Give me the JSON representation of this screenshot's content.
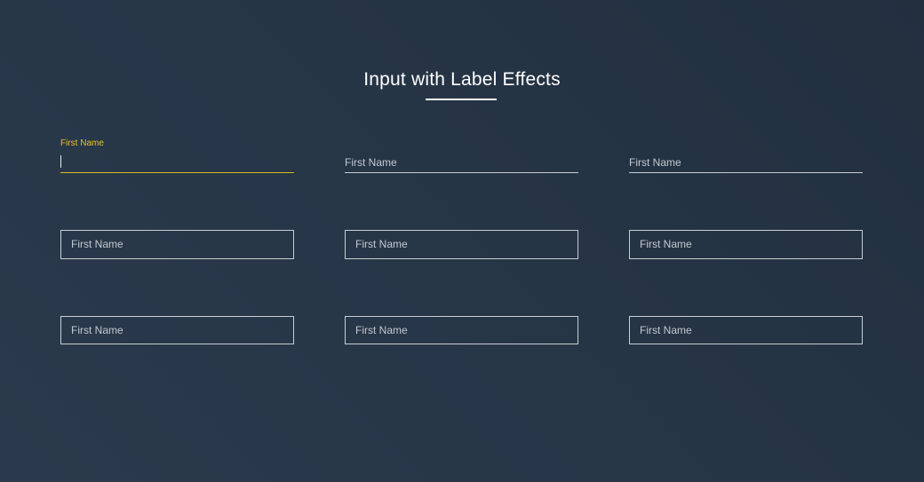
{
  "heading": {
    "title": "Input with Label Effects"
  },
  "colors": {
    "accent": "#f1c21b",
    "field_border": "#c9ced4",
    "label_text": "#c3c8cf",
    "background": "#263546"
  },
  "rows": [
    {
      "style": "underline",
      "fields": [
        {
          "label": "First Name",
          "value": "",
          "focused": true
        },
        {
          "label": "First Name",
          "value": "",
          "focused": false
        },
        {
          "label": "First Name",
          "value": "",
          "focused": false
        }
      ]
    },
    {
      "style": "boxed",
      "fields": [
        {
          "label": "First Name",
          "value": "",
          "focused": false
        },
        {
          "label": "First Name",
          "value": "",
          "focused": false
        },
        {
          "label": "First Name",
          "value": "",
          "focused": false
        }
      ]
    },
    {
      "style": "boxed",
      "fields": [
        {
          "label": "First Name",
          "value": "",
          "focused": false
        },
        {
          "label": "First Name",
          "value": "",
          "focused": false
        },
        {
          "label": "First Name",
          "value": "",
          "focused": false
        }
      ]
    }
  ]
}
